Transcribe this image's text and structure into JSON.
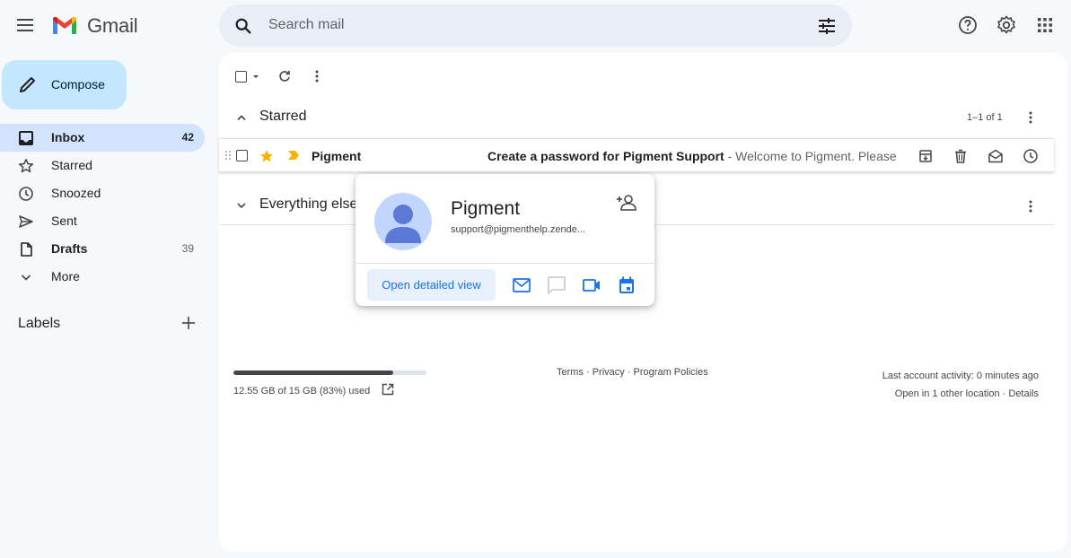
{
  "app": {
    "name": "Gmail"
  },
  "search": {
    "placeholder": "Search mail"
  },
  "compose": {
    "label": "Compose"
  },
  "sidebar": {
    "items": [
      {
        "label": "Inbox",
        "count": "42",
        "icon": "inbox-icon"
      },
      {
        "label": "Starred",
        "count": "",
        "icon": "star-outline-icon"
      },
      {
        "label": "Snoozed",
        "count": "",
        "icon": "clock-icon"
      },
      {
        "label": "Sent",
        "count": "",
        "icon": "send-icon"
      },
      {
        "label": "Drafts",
        "count": "39",
        "icon": "draft-icon"
      },
      {
        "label": "More",
        "count": "",
        "icon": "chevron-down-icon"
      }
    ],
    "labels_heading": "Labels"
  },
  "sections": {
    "starred": {
      "title": "Starred",
      "range": "1–1 of 1"
    },
    "everything_else": {
      "title": "Everything else"
    }
  },
  "email_row": {
    "sender": "Pigment",
    "subject": "Create a password for Pigment Support",
    "snippet": " - Welcome to Pigment. Please create a password"
  },
  "storage": {
    "text": "12.55 GB of 15 GB (83%) used",
    "used_fraction": 0.83
  },
  "footer": {
    "links": "Terms · Privacy · Program Policies",
    "activity": "Last account activity: 0 minutes ago",
    "locations": "Open in 1 other location · Details"
  },
  "contact_card": {
    "name": "Pigment",
    "email": "support@pigmenthelp.zende...",
    "detail_button": "Open detailed view"
  },
  "colors": {
    "accent": "#1a73e8",
    "compose_bg": "#c2e7ff",
    "nav_active": "#d3e3fd",
    "star": "#f4b400",
    "important": "#f4b400"
  }
}
